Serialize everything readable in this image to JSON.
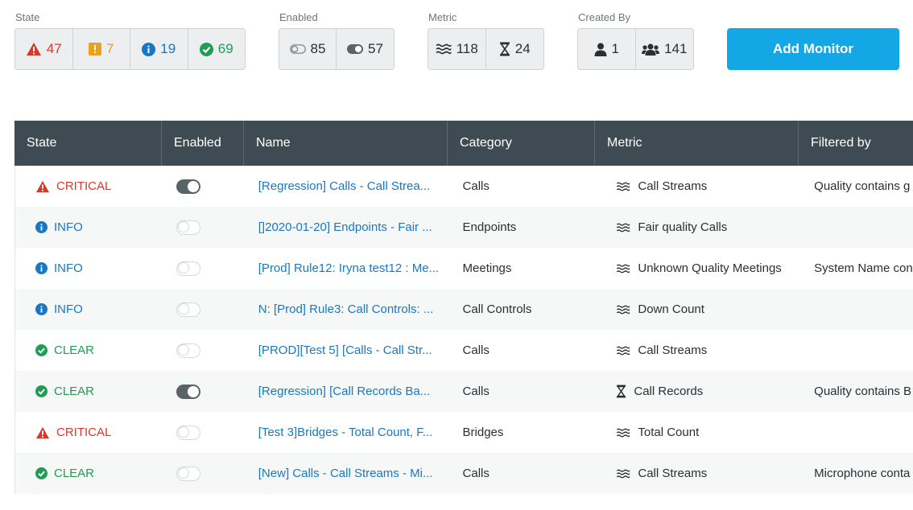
{
  "filters": {
    "state": {
      "title": "State",
      "items": [
        {
          "icon": "warning-triangle-icon",
          "count": "47",
          "color": "#d43a2c"
        },
        {
          "icon": "warning-square-icon",
          "count": "7",
          "color": "#e9a21b"
        },
        {
          "icon": "info-circle-icon",
          "count": "19",
          "color": "#1a78c2"
        },
        {
          "icon": "check-circle-icon",
          "count": "69",
          "color": "#1f9d55"
        }
      ]
    },
    "enabled": {
      "title": "Enabled",
      "items": [
        {
          "icon": "toggle-off-icon",
          "count": "85"
        },
        {
          "icon": "toggle-on-icon",
          "count": "57"
        }
      ]
    },
    "metric": {
      "title": "Metric",
      "items": [
        {
          "icon": "waves-icon",
          "count": "118"
        },
        {
          "icon": "hourglass-icon",
          "count": "24"
        }
      ]
    },
    "created_by": {
      "title": "Created By",
      "items": [
        {
          "icon": "user-icon",
          "count": "1"
        },
        {
          "icon": "users-icon",
          "count": "141"
        }
      ]
    }
  },
  "add_monitor_label": "Add Monitor",
  "table": {
    "columns": [
      "State",
      "Enabled",
      "Name",
      "Category",
      "Metric",
      "Filtered by"
    ],
    "rows": [
      {
        "state": "CRITICAL",
        "state_icon": "warning-triangle-icon",
        "enabled": true,
        "name": "[Regression] Calls - Call Strea...",
        "category": "Calls",
        "metric_icon": "waves-icon",
        "metric": "Call Streams",
        "filtered_by": "Quality contains g"
      },
      {
        "state": "INFO",
        "state_icon": "info-circle-icon",
        "enabled": false,
        "name": "[]2020-01-20] Endpoints - Fair ...",
        "category": "Endpoints",
        "metric_icon": "waves-icon",
        "metric": "Fair quality Calls",
        "filtered_by": ""
      },
      {
        "state": "INFO",
        "state_icon": "info-circle-icon",
        "enabled": false,
        "name": "[Prod] Rule12: Iryna test12 : Me...",
        "category": "Meetings",
        "metric_icon": "waves-icon",
        "metric": "Unknown Quality Meetings",
        "filtered_by": "System Name con"
      },
      {
        "state": "INFO",
        "state_icon": "info-circle-icon",
        "enabled": false,
        "name": "N: [Prod] Rule3: Call Controls: ...",
        "category": "Call Controls",
        "metric_icon": "waves-icon",
        "metric": "Down Count",
        "filtered_by": ""
      },
      {
        "state": "CLEAR",
        "state_icon": "check-circle-icon",
        "enabled": false,
        "name": "[PROD][Test 5] [Calls - Call Str...",
        "category": "Calls",
        "metric_icon": "waves-icon",
        "metric": "Call Streams",
        "filtered_by": ""
      },
      {
        "state": "CLEAR",
        "state_icon": "check-circle-icon",
        "enabled": true,
        "name": "[Regression] [Call Records Ba...",
        "category": "Calls",
        "metric_icon": "hourglass-icon",
        "metric": "Call Records",
        "filtered_by": "Quality contains B"
      },
      {
        "state": "CRITICAL",
        "state_icon": "warning-triangle-icon",
        "enabled": false,
        "name": "[Test 3]Bridges - Total Count, F...",
        "category": "Bridges",
        "metric_icon": "waves-icon",
        "metric": "Total Count",
        "filtered_by": ""
      },
      {
        "state": "CLEAR",
        "state_icon": "check-circle-icon",
        "enabled": false,
        "name": "[New] Calls - Call Streams - Mi...",
        "category": "Calls",
        "metric_icon": "waves-icon",
        "metric": "Call Streams",
        "filtered_by": "Microphone conta"
      }
    ]
  },
  "colors": {
    "critical": "#d43a2c",
    "warning": "#e9a21b",
    "info": "#1a78c2",
    "clear": "#1f9d55",
    "accent": "#13a7e6",
    "header_bg": "#3f4b52"
  }
}
